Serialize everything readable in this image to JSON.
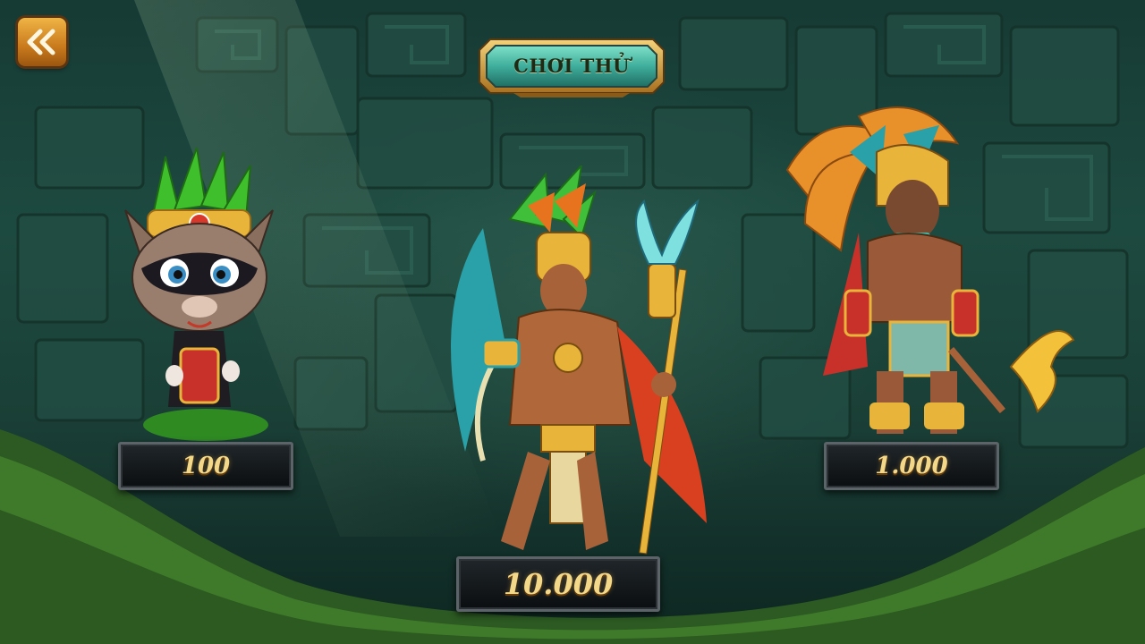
{
  "header": {
    "back_icon": "double-chevron-left-icon",
    "play_trial_label": "CHƠI THỬ"
  },
  "characters": [
    {
      "id": "cat-warrior",
      "price": "100"
    },
    {
      "id": "aztec-priest",
      "price": "10.000"
    },
    {
      "id": "aztec-chief",
      "price": "1.000"
    }
  ],
  "colors": {
    "accent_gold": "#f4d88a",
    "button_teal": "#3fae9c",
    "button_gold": "#d9a441",
    "plate_dark": "#0b0e10"
  }
}
